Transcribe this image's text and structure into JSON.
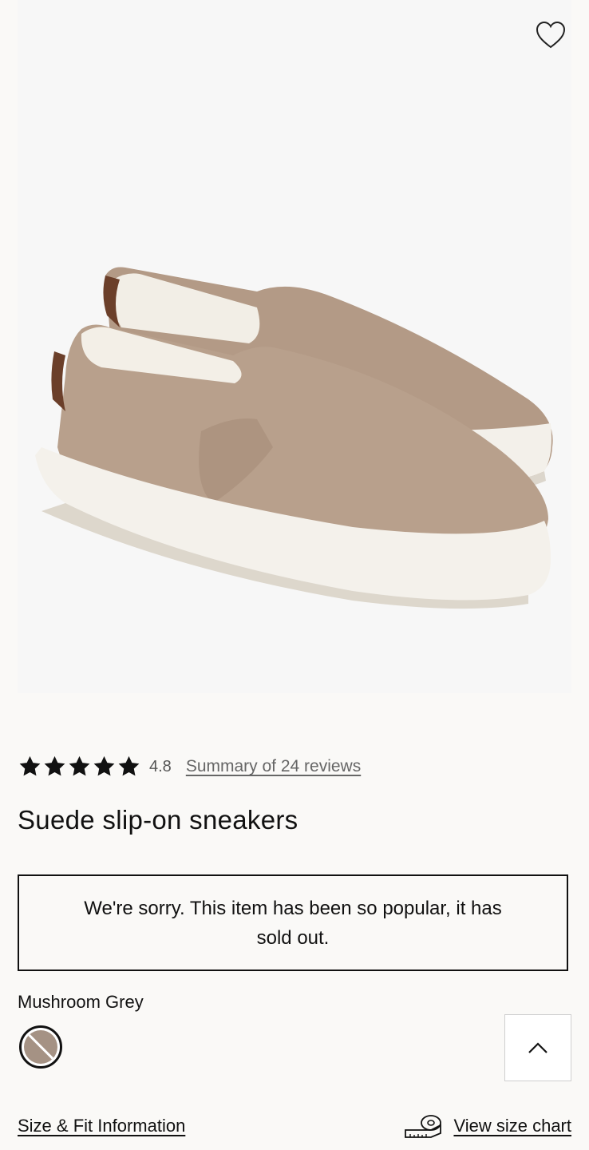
{
  "product": {
    "title": "Suede slip-on sneakers",
    "image_alt": "Suede slip-on sneakers product image",
    "favorite_icon": "heart-outline-icon"
  },
  "rating": {
    "stars": 5,
    "value": "4.8",
    "reviews_link": "Summary of 24 reviews",
    "star_color": "#111111"
  },
  "availability": {
    "message": "We're sorry. This item has been so popular, it has sold out."
  },
  "color": {
    "label": "Mushroom Grey",
    "swatch_color": "#a59284",
    "swatch_unavailable": true
  },
  "back_to_top": {
    "icon": "chevron-up-icon"
  },
  "footer_links": {
    "size_fit": "Size & Fit Information",
    "size_chart": "View size chart",
    "size_chart_icon": "measuring-tape-icon"
  }
}
